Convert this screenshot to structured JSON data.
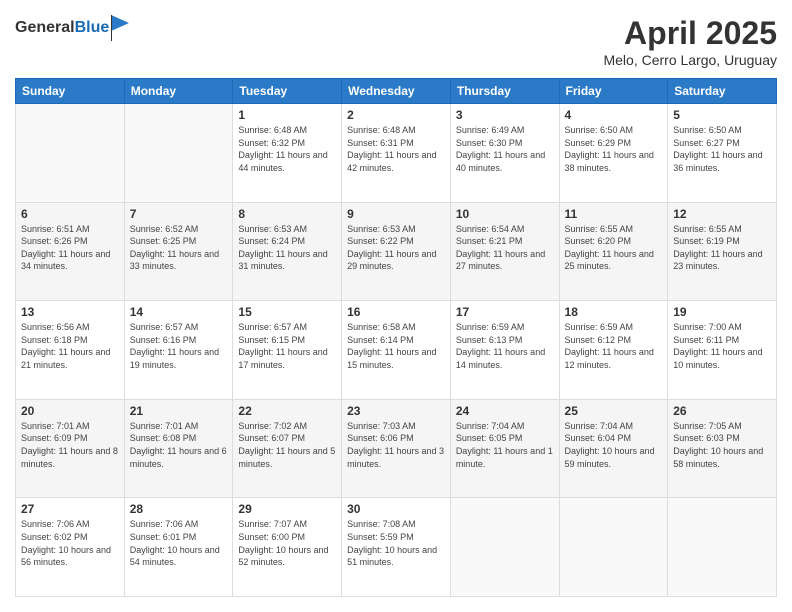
{
  "header": {
    "logo_general": "General",
    "logo_blue": "Blue",
    "title": "April 2025",
    "location": "Melo, Cerro Largo, Uruguay"
  },
  "weekdays": [
    "Sunday",
    "Monday",
    "Tuesday",
    "Wednesday",
    "Thursday",
    "Friday",
    "Saturday"
  ],
  "weeks": [
    [
      {
        "day": "",
        "detail": ""
      },
      {
        "day": "",
        "detail": ""
      },
      {
        "day": "1",
        "detail": "Sunrise: 6:48 AM\nSunset: 6:32 PM\nDaylight: 11 hours and 44 minutes."
      },
      {
        "day": "2",
        "detail": "Sunrise: 6:48 AM\nSunset: 6:31 PM\nDaylight: 11 hours and 42 minutes."
      },
      {
        "day": "3",
        "detail": "Sunrise: 6:49 AM\nSunset: 6:30 PM\nDaylight: 11 hours and 40 minutes."
      },
      {
        "day": "4",
        "detail": "Sunrise: 6:50 AM\nSunset: 6:29 PM\nDaylight: 11 hours and 38 minutes."
      },
      {
        "day": "5",
        "detail": "Sunrise: 6:50 AM\nSunset: 6:27 PM\nDaylight: 11 hours and 36 minutes."
      }
    ],
    [
      {
        "day": "6",
        "detail": "Sunrise: 6:51 AM\nSunset: 6:26 PM\nDaylight: 11 hours and 34 minutes."
      },
      {
        "day": "7",
        "detail": "Sunrise: 6:52 AM\nSunset: 6:25 PM\nDaylight: 11 hours and 33 minutes."
      },
      {
        "day": "8",
        "detail": "Sunrise: 6:53 AM\nSunset: 6:24 PM\nDaylight: 11 hours and 31 minutes."
      },
      {
        "day": "9",
        "detail": "Sunrise: 6:53 AM\nSunset: 6:22 PM\nDaylight: 11 hours and 29 minutes."
      },
      {
        "day": "10",
        "detail": "Sunrise: 6:54 AM\nSunset: 6:21 PM\nDaylight: 11 hours and 27 minutes."
      },
      {
        "day": "11",
        "detail": "Sunrise: 6:55 AM\nSunset: 6:20 PM\nDaylight: 11 hours and 25 minutes."
      },
      {
        "day": "12",
        "detail": "Sunrise: 6:55 AM\nSunset: 6:19 PM\nDaylight: 11 hours and 23 minutes."
      }
    ],
    [
      {
        "day": "13",
        "detail": "Sunrise: 6:56 AM\nSunset: 6:18 PM\nDaylight: 11 hours and 21 minutes."
      },
      {
        "day": "14",
        "detail": "Sunrise: 6:57 AM\nSunset: 6:16 PM\nDaylight: 11 hours and 19 minutes."
      },
      {
        "day": "15",
        "detail": "Sunrise: 6:57 AM\nSunset: 6:15 PM\nDaylight: 11 hours and 17 minutes."
      },
      {
        "day": "16",
        "detail": "Sunrise: 6:58 AM\nSunset: 6:14 PM\nDaylight: 11 hours and 15 minutes."
      },
      {
        "day": "17",
        "detail": "Sunrise: 6:59 AM\nSunset: 6:13 PM\nDaylight: 11 hours and 14 minutes."
      },
      {
        "day": "18",
        "detail": "Sunrise: 6:59 AM\nSunset: 6:12 PM\nDaylight: 11 hours and 12 minutes."
      },
      {
        "day": "19",
        "detail": "Sunrise: 7:00 AM\nSunset: 6:11 PM\nDaylight: 11 hours and 10 minutes."
      }
    ],
    [
      {
        "day": "20",
        "detail": "Sunrise: 7:01 AM\nSunset: 6:09 PM\nDaylight: 11 hours and 8 minutes."
      },
      {
        "day": "21",
        "detail": "Sunrise: 7:01 AM\nSunset: 6:08 PM\nDaylight: 11 hours and 6 minutes."
      },
      {
        "day": "22",
        "detail": "Sunrise: 7:02 AM\nSunset: 6:07 PM\nDaylight: 11 hours and 5 minutes."
      },
      {
        "day": "23",
        "detail": "Sunrise: 7:03 AM\nSunset: 6:06 PM\nDaylight: 11 hours and 3 minutes."
      },
      {
        "day": "24",
        "detail": "Sunrise: 7:04 AM\nSunset: 6:05 PM\nDaylight: 11 hours and 1 minute."
      },
      {
        "day": "25",
        "detail": "Sunrise: 7:04 AM\nSunset: 6:04 PM\nDaylight: 10 hours and 59 minutes."
      },
      {
        "day": "26",
        "detail": "Sunrise: 7:05 AM\nSunset: 6:03 PM\nDaylight: 10 hours and 58 minutes."
      }
    ],
    [
      {
        "day": "27",
        "detail": "Sunrise: 7:06 AM\nSunset: 6:02 PM\nDaylight: 10 hours and 56 minutes."
      },
      {
        "day": "28",
        "detail": "Sunrise: 7:06 AM\nSunset: 6:01 PM\nDaylight: 10 hours and 54 minutes."
      },
      {
        "day": "29",
        "detail": "Sunrise: 7:07 AM\nSunset: 6:00 PM\nDaylight: 10 hours and 52 minutes."
      },
      {
        "day": "30",
        "detail": "Sunrise: 7:08 AM\nSunset: 5:59 PM\nDaylight: 10 hours and 51 minutes."
      },
      {
        "day": "",
        "detail": ""
      },
      {
        "day": "",
        "detail": ""
      },
      {
        "day": "",
        "detail": ""
      }
    ]
  ]
}
